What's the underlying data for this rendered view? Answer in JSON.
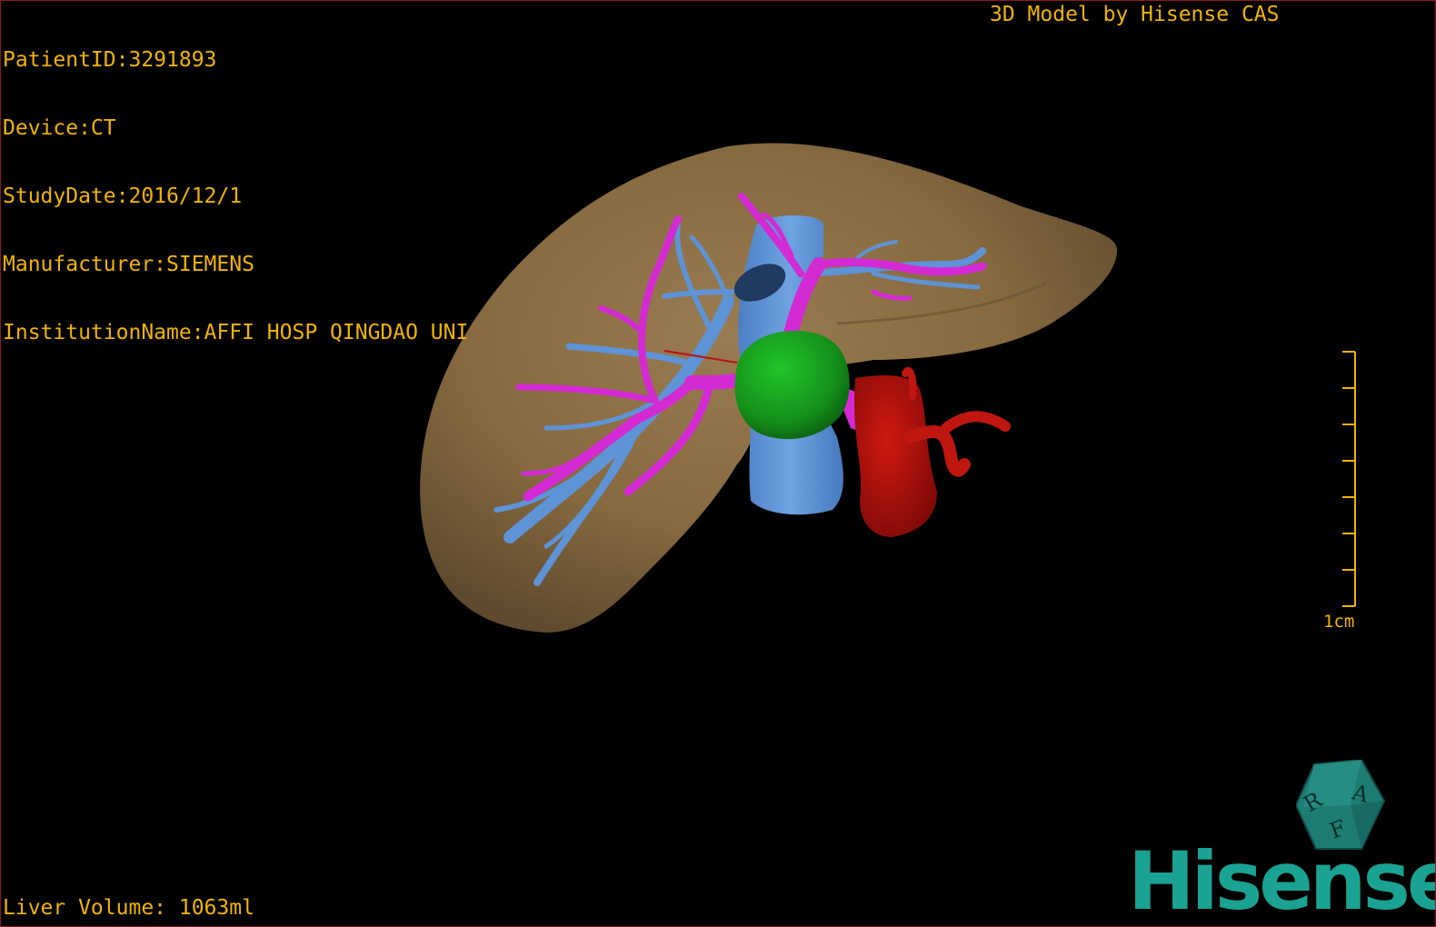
{
  "dicom": {
    "patient_id": "PatientID:3291893",
    "device": "Device:CT",
    "study_date": "StudyDate:2016/12/1",
    "manufacturer": "Manufacturer:SIEMENS",
    "institution": "InstitutionName:AFFI HOSP QINGDAO UNI"
  },
  "credit": "3D Model by Hisense CAS",
  "liver_volume": "Liver Volume: 1063ml",
  "scale": {
    "label": "1cm"
  },
  "orientation_cube": {
    "faces": [
      "R",
      "A",
      "F"
    ]
  },
  "brand": {
    "name": "Hisense",
    "color": "#1aa392"
  },
  "colors": {
    "overlay_text": "#f0b400",
    "liver": "#8a6e48",
    "hepatic_vein": "#5e93d6",
    "portal_vein": "#d42ad4",
    "tumor": "#159c1e",
    "artery": "#b8120e"
  },
  "icons": {
    "orientation": "orientation-cube-icon",
    "scale": "scale-bar-icon"
  }
}
